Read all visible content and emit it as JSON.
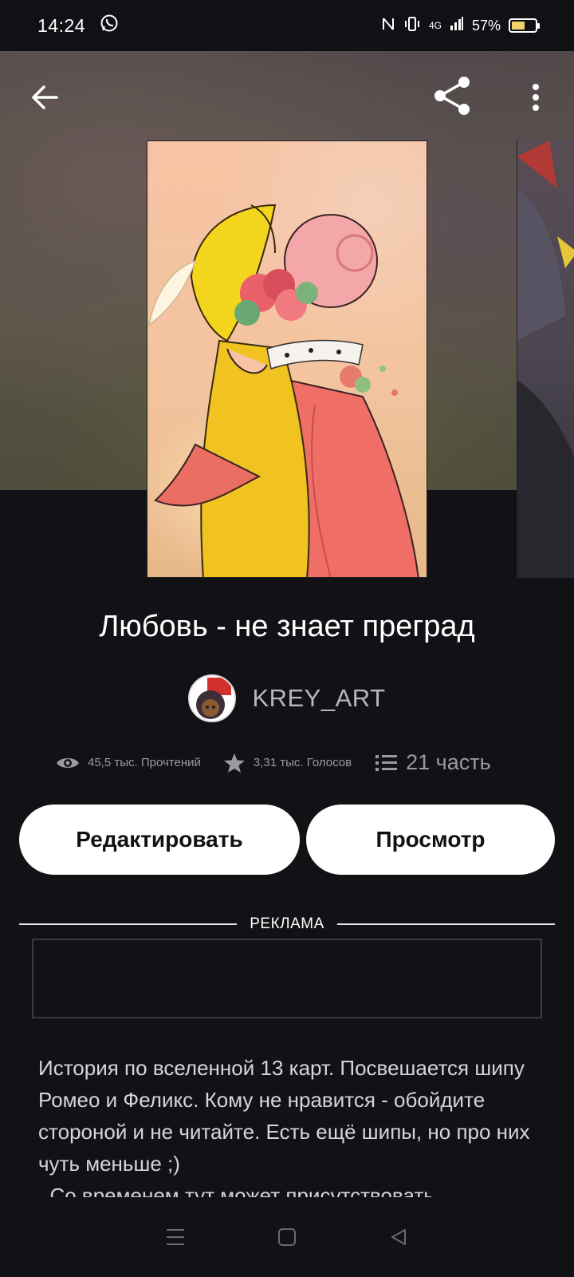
{
  "status_bar": {
    "time": "14:24",
    "network": "4G",
    "battery": "57%",
    "battery_level": 0.57,
    "icons": [
      "whatsapp-icon",
      "nfc-icon",
      "vibrate-icon",
      "signal-icon",
      "battery-icon"
    ]
  },
  "toolbar": {
    "icons": [
      "back-arrow-icon",
      "share-icon",
      "more-vertical-icon"
    ]
  },
  "story": {
    "title": "Любовь - не знает преград",
    "author": "KREY_ART",
    "stats": {
      "reads": "45,5 тыс. Прочтений",
      "votes": "3,31 тыс. Голосов",
      "parts": "21 часть"
    },
    "description": "История по вселенной 13 карт. Посвешается шипу Ромео и Феликс. Кому не нравится - обойдите стороной и не читайте. Есть ещё шипы, но про них чуть меньше ;)\n  Со временем тут может присутствовать"
  },
  "actions": {
    "edit_label": "Редактировать",
    "view_label": "Просмотр"
  },
  "ad": {
    "label": "РЕКЛАМА"
  },
  "nav": {
    "icons": [
      "menu-icon",
      "home-icon",
      "back-icon"
    ]
  },
  "colors": {
    "background": "#121115",
    "button_bg": "#ffffff",
    "text_secondary": "#9b9b9f"
  }
}
